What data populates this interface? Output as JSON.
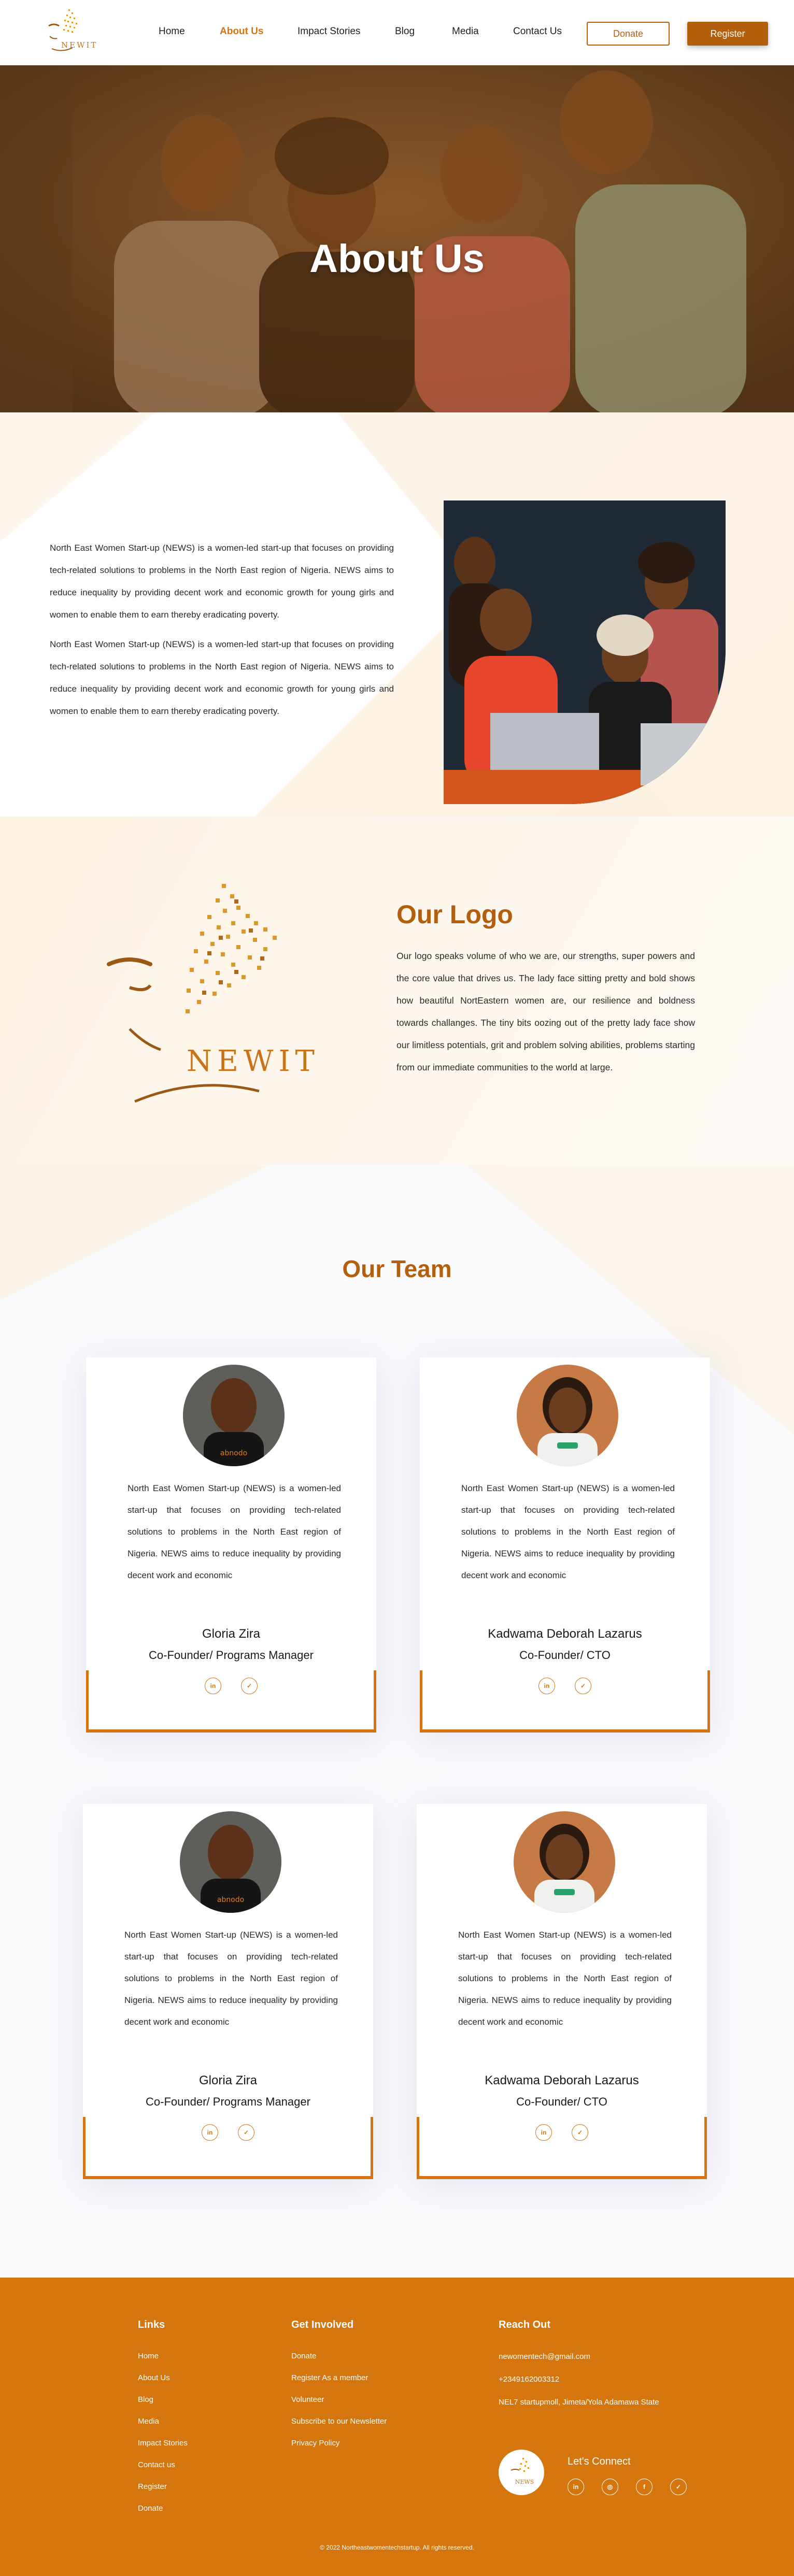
{
  "header": {
    "logo_text": "NEWIT",
    "nav": [
      {
        "label": "Home"
      },
      {
        "label": "About Us",
        "active": true
      },
      {
        "label": "Impact Stories"
      },
      {
        "label": "Blog"
      },
      {
        "label": "Media"
      },
      {
        "label": "Contact Us"
      }
    ],
    "donate_label": "Donate",
    "register_label": "Register"
  },
  "hero": {
    "title": "About Us"
  },
  "intro": {
    "paragraphs": [
      "North East Women Start-up (NEWS) is a women-led start-up that focuses on providing tech-related solutions to problems in the North East region of Nigeria. NEWS aims to reduce inequality by providing decent work and economic growth for young girls and women to enable them to earn thereby eradicating poverty.",
      "North East Women Start-up (NEWS) is a women-led start-up that focuses on providing tech-related solutions to problems in the North East region of Nigeria. NEWS aims to reduce inequality by providing decent work and economic growth for young girls and women to enable them to earn thereby eradicating poverty."
    ]
  },
  "logo_section": {
    "title": "Our Logo",
    "logo_word": "NEWIT",
    "description": "Our logo speaks volume of who we are, our strengths, super powers and the core value that drives us. The lady face sitting pretty and bold shows how beautiful NortEastern women are, our resilience and boldness  towards challanges. The tiny bits oozing out of the pretty lady face show our limitless potentials, grit and problem solving abilities, problems starting from our immediate communities to the world at large."
  },
  "team": {
    "title": "Our Team",
    "members": [
      {
        "bio": "North East Women Start-up (NEWS) is a women-led start-up that focuses on providing tech-related solutions to problems in the North East region of Nigeria. NEWS aims to reduce inequality by providing decent work and economic",
        "name": "Gloria Zira",
        "role": "Co-Founder/ Programs Manager"
      },
      {
        "bio": "North East Women Start-up (NEWS) is a women-led start-up that focuses on providing tech-related solutions to problems in the North East region of Nigeria. NEWS aims to reduce inequality by providing decent work and economic",
        "name": "Kadwama Deborah Lazarus",
        "role": "Co-Founder/ CTO"
      },
      {
        "bio": "North East Women Start-up (NEWS) is a women-led start-up that focuses on providing tech-related solutions to problems in the North East region of Nigeria. NEWS aims to reduce inequality by providing decent work and economic",
        "name": "Gloria Zira",
        "role": "Co-Founder/ Programs Manager"
      },
      {
        "bio": "North East Women Start-up (NEWS) is a women-led start-up that focuses on providing tech-related solutions to problems in the North East region of Nigeria. NEWS aims to reduce inequality by providing decent work and economic",
        "name": "Kadwama Deborah Lazarus",
        "role": "Co-Founder/ CTO"
      }
    ],
    "social_icons": [
      "linkedin-icon",
      "twitter-icon"
    ]
  },
  "footer": {
    "links": {
      "title": "Links",
      "items": [
        "Home",
        "About Us",
        "Blog",
        "Media",
        "Impact Stories",
        "Contact us",
        "Register",
        "Donate"
      ]
    },
    "get_involved": {
      "title": "Get Involved",
      "items": [
        "Donate",
        "Register As a member",
        "Volunteer",
        "Subscribe to our Newsletter",
        "Privacy Policy"
      ]
    },
    "reach_out": {
      "title": "Reach Out",
      "email": "newomentech@gmail.com",
      "phone": "+2349162003312",
      "address": "NEL7 startupmoll, Jimeta/Yola Adamawa State"
    },
    "connect_label": "Let's Connect",
    "social_icons": [
      "linkedin-icon",
      "instagram-icon",
      "facebook-icon",
      "twitter-icon"
    ],
    "copyright": "2022 Northeastwomentechstartup. All rights reserved.",
    "logo_text": "NEWS"
  },
  "colors": {
    "brand": "#d27512",
    "brand_dark": "#b45f0b",
    "footer": "#d4750d"
  }
}
